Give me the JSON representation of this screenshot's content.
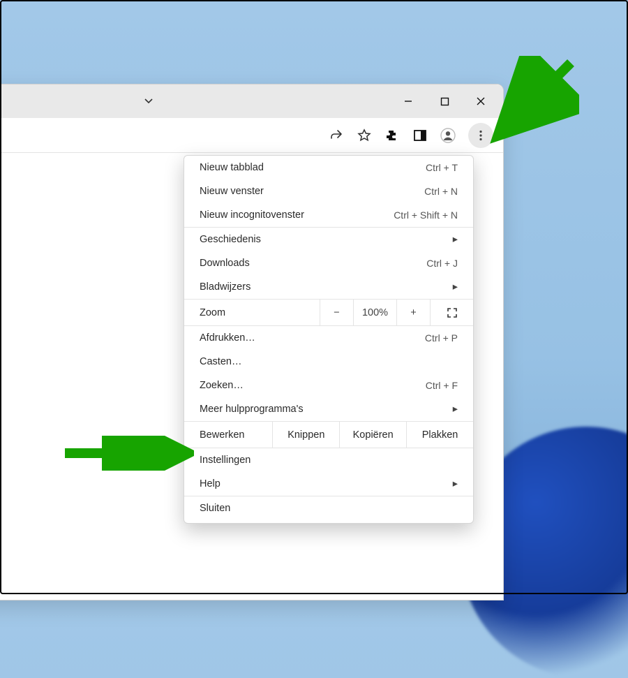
{
  "window": {
    "titlebar_icons": {
      "chevron": "chevron-down",
      "minimize": "minimize",
      "maximize": "maximize",
      "close": "close"
    }
  },
  "toolbar": {
    "share_icon": "share",
    "star_icon": "star",
    "puzzle_icon": "extensions",
    "sidepanel_icon": "side-panel",
    "profile_icon": "profile",
    "kebab_icon": "more-vertical"
  },
  "menu": {
    "section1": [
      {
        "label": "Nieuw tabblad",
        "shortcut": "Ctrl + T"
      },
      {
        "label": "Nieuw venster",
        "shortcut": "Ctrl + N"
      },
      {
        "label": "Nieuw incognitovenster",
        "shortcut": "Ctrl + Shift + N"
      }
    ],
    "section2": [
      {
        "label": "Geschiedenis",
        "submenu": true
      },
      {
        "label": "Downloads",
        "shortcut": "Ctrl + J"
      },
      {
        "label": "Bladwijzers",
        "submenu": true
      }
    ],
    "zoom": {
      "label": "Zoom",
      "minus": "−",
      "value": "100%",
      "plus": "+",
      "fullscreen_icon": "fullscreen"
    },
    "section3": [
      {
        "label": "Afdrukken…",
        "shortcut": "Ctrl + P"
      },
      {
        "label": "Casten…"
      },
      {
        "label": "Zoeken…",
        "shortcut": "Ctrl + F"
      },
      {
        "label": "Meer hulpprogramma's",
        "submenu": true
      }
    ],
    "edit": {
      "label": "Bewerken",
      "cut": "Knippen",
      "copy": "Kopiëren",
      "paste": "Plakken"
    },
    "section4": [
      {
        "label": "Instellingen"
      },
      {
        "label": "Help",
        "submenu": true
      }
    ],
    "section5": [
      {
        "label": "Sluiten"
      }
    ]
  },
  "arrows": {
    "top": "arrow pointing to kebab menu",
    "left": "arrow pointing to Instellingen"
  }
}
